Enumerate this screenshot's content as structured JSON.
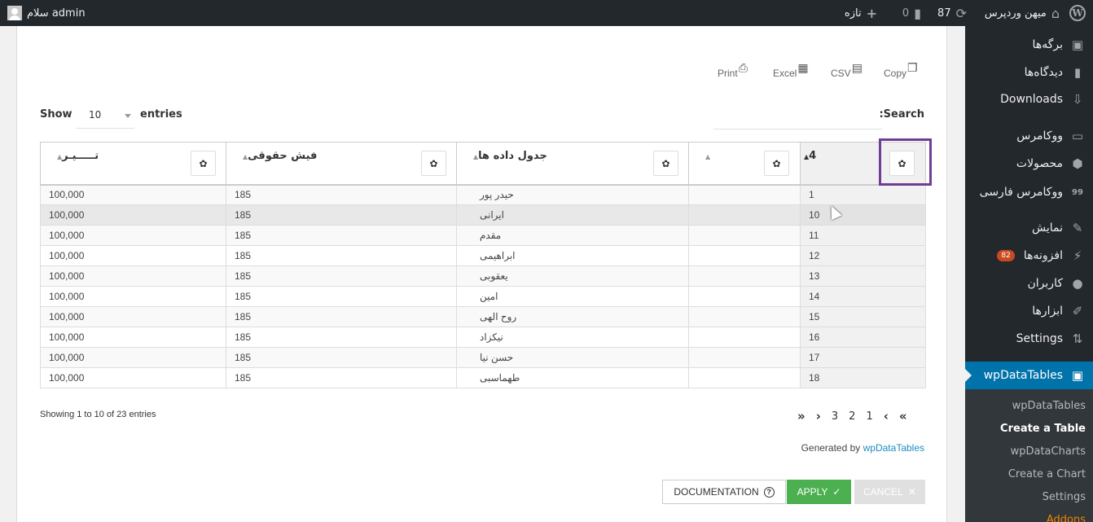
{
  "adminbar": {
    "greeting": "سلام admin",
    "site_name": "میهن وردپرس",
    "updates_count": "87",
    "comments_count": "0",
    "new_label": "تازه"
  },
  "sidebar": {
    "items": [
      {
        "label": "برگه‌ها",
        "icon": "pages-icon"
      },
      {
        "label": "دیدگاه‌ها",
        "icon": "comments-icon"
      },
      {
        "label": "Downloads",
        "icon": "downloads-icon"
      },
      {
        "label": "ووکامرس",
        "icon": "woo-icon"
      },
      {
        "label": "محصولات",
        "icon": "products-icon"
      },
      {
        "label": "ووکامرس فارسی",
        "icon": "woo-persian-icon"
      },
      {
        "label": "نمایش",
        "icon": "appearance-icon"
      },
      {
        "label": "افزونه‌ها",
        "icon": "plugins-icon",
        "badge": "82"
      },
      {
        "label": "کاربران",
        "icon": "users-icon"
      },
      {
        "label": "ابزارها",
        "icon": "tools-icon"
      },
      {
        "label": "Settings",
        "icon": "settings-icon"
      },
      {
        "label": "wpDataTables",
        "icon": "wpdatatables-icon",
        "active": true
      }
    ],
    "submenu": [
      {
        "label": "wpDataTables"
      },
      {
        "label": "Create a Table",
        "current": true
      },
      {
        "label": "wpDataCharts"
      },
      {
        "label": "Create a Chart"
      },
      {
        "label": "Settings"
      },
      {
        "label": "Addons"
      }
    ]
  },
  "toolbar": {
    "export_buttons": [
      {
        "label": "Copy",
        "icon": "copy-icon"
      },
      {
        "label": "CSV",
        "icon": "csv-icon"
      },
      {
        "label": "Excel",
        "icon": "excel-icon"
      },
      {
        "label": "Print",
        "icon": "print-icon"
      }
    ],
    "show_label": "Show",
    "entries_label": "entries",
    "page_length": "10",
    "search_label": ":Search",
    "search_value": ""
  },
  "table": {
    "columns": [
      {
        "label": "4"
      },
      {
        "label": ""
      },
      {
        "label": "جدول داده ها"
      },
      {
        "label": "فیش حقوقی"
      },
      {
        "label": "تـــــیـر"
      }
    ],
    "rows": [
      [
        "1",
        "",
        "حیدر پور",
        "185",
        "100,000"
      ],
      [
        "10",
        "",
        "ایرانی",
        "185",
        "100,000"
      ],
      [
        "11",
        "",
        "مقدم",
        "185",
        "100,000"
      ],
      [
        "12",
        "",
        "ابراهیمی",
        "185",
        "100,000"
      ],
      [
        "13",
        "",
        "یعقوبی",
        "185",
        "100,000"
      ],
      [
        "14",
        "",
        "امین",
        "185",
        "100,000"
      ],
      [
        "15",
        "",
        "روح الهی",
        "185",
        "100,000"
      ],
      [
        "16",
        "",
        "نیکزاد",
        "185",
        "100,000"
      ],
      [
        "17",
        "",
        "حسن نیا",
        "185",
        "100,000"
      ],
      [
        "18",
        "",
        "طهماسبی",
        "185",
        "100,000"
      ]
    ]
  },
  "footer": {
    "info": "Showing 1 to 10 of 23 entries",
    "pages": [
      "3",
      "2",
      "1"
    ],
    "generated_by": "Generated by",
    "generated_link": "wpDataTables"
  },
  "actions": {
    "documentation": "DOCUMENTATION",
    "apply": "APPLY",
    "cancel": "CANCEL"
  }
}
